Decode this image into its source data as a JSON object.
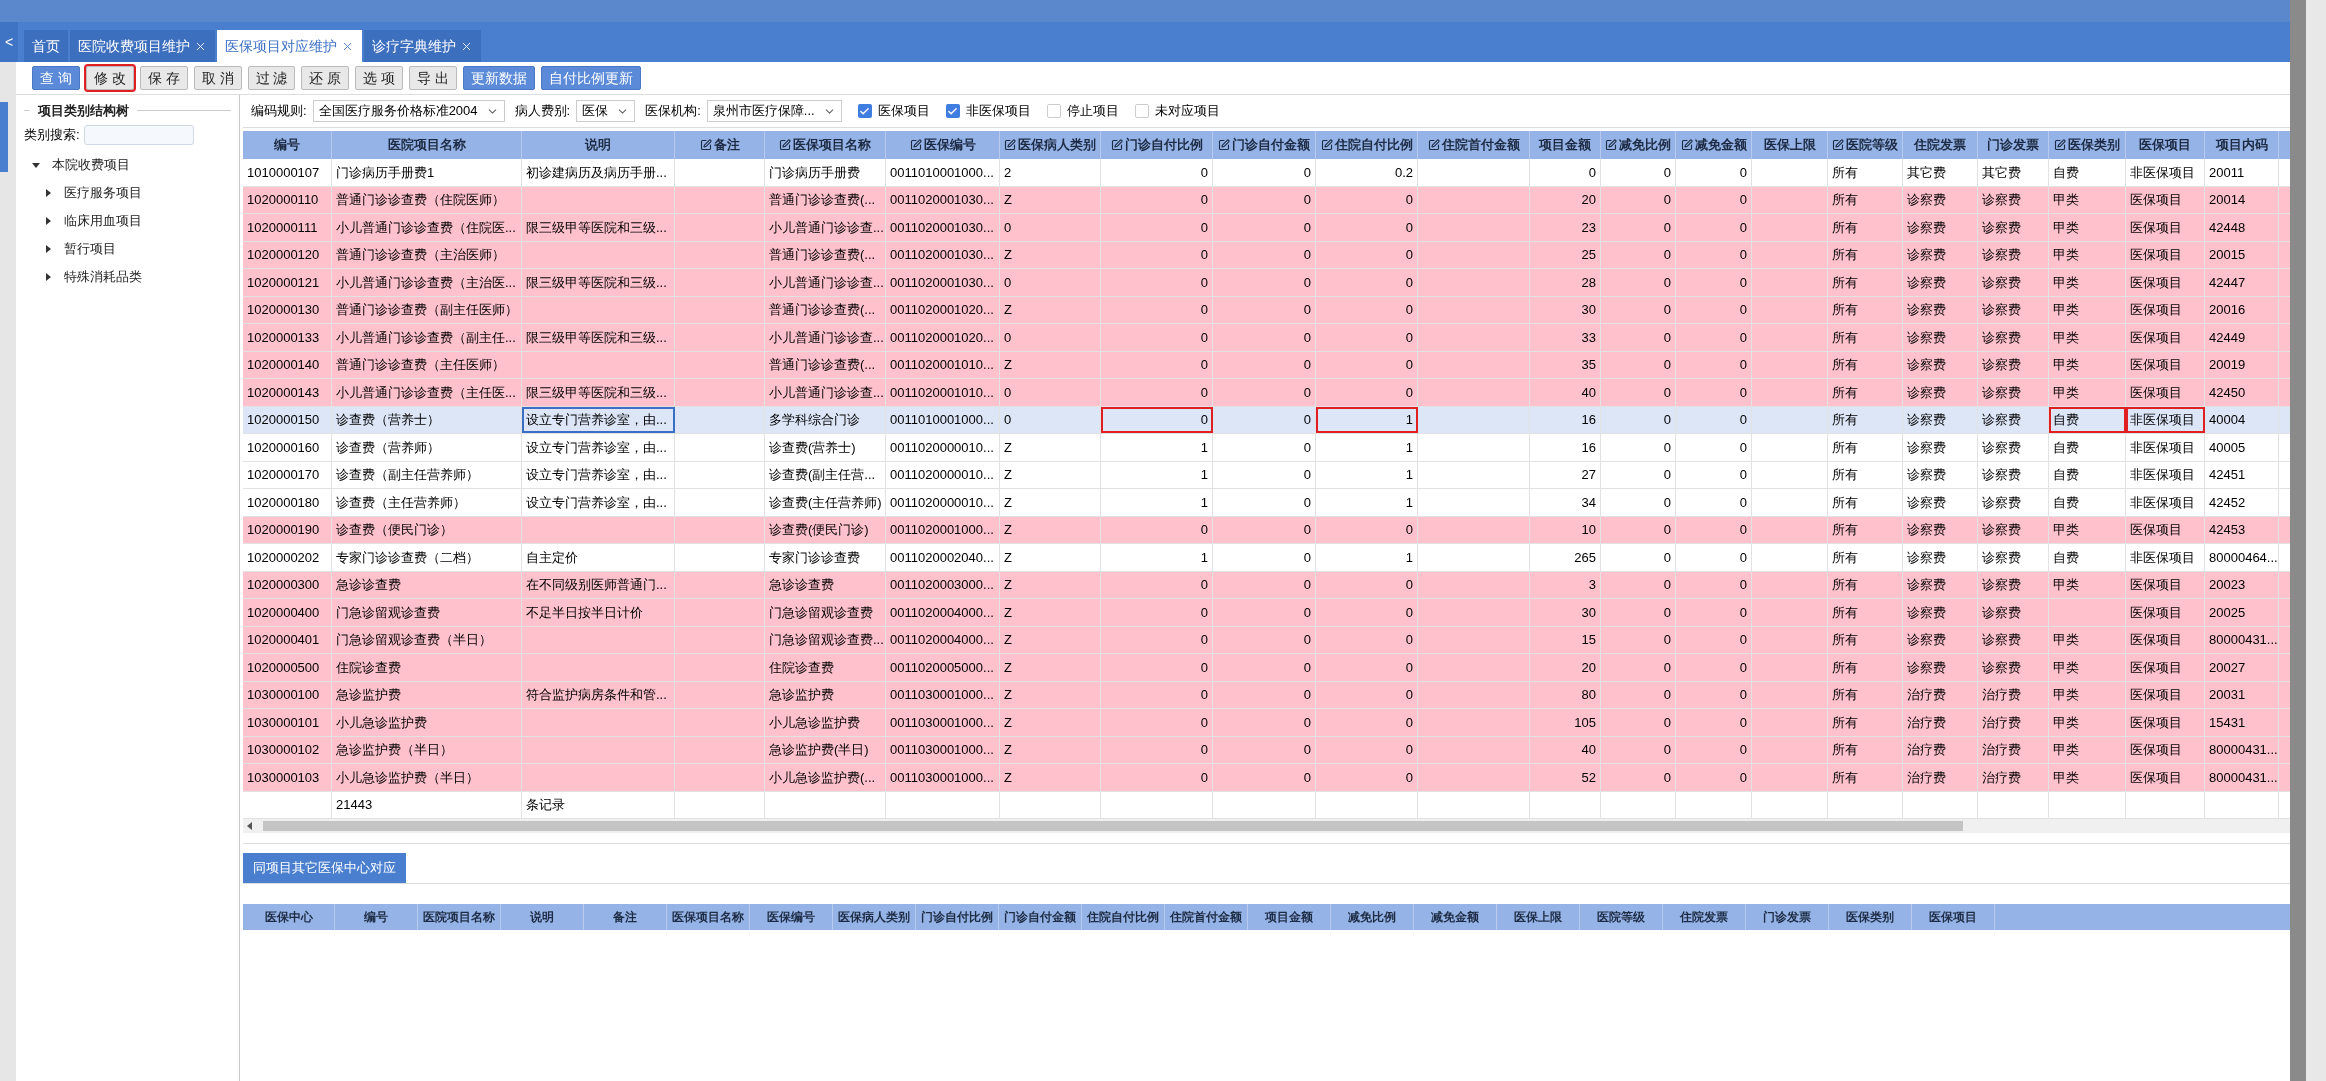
{
  "nav_back": "<",
  "tabs": [
    {
      "label": "首页",
      "closable": false,
      "selected": false
    },
    {
      "label": "医院收费项目维护",
      "closable": true,
      "selected": false
    },
    {
      "label": "医保项目对应维护",
      "closable": true,
      "selected": true
    },
    {
      "label": "诊疗字典维护",
      "closable": true,
      "selected": false
    }
  ],
  "toolbar": [
    {
      "label": "查 询",
      "kind": "primary",
      "marked": false
    },
    {
      "label": "修 改",
      "kind": "default",
      "marked": true
    },
    {
      "label": "保 存",
      "kind": "default",
      "marked": false
    },
    {
      "label": "取 消",
      "kind": "default",
      "marked": false
    },
    {
      "label": "过 滤",
      "kind": "default",
      "marked": false
    },
    {
      "label": "还 原",
      "kind": "default",
      "marked": false
    },
    {
      "label": "选 项",
      "kind": "default",
      "marked": false
    },
    {
      "label": "导 出",
      "kind": "default",
      "marked": false
    },
    {
      "label": "更新数据",
      "kind": "primary",
      "marked": false
    },
    {
      "label": "自付比例更新",
      "kind": "primary",
      "marked": false
    }
  ],
  "sidebar": {
    "title": "项目类别结构树",
    "search_label": "类别搜索:",
    "tree": [
      {
        "label": "本院收费项目",
        "expanded": true,
        "children": [
          {
            "label": "医疗服务项目",
            "expanded": false
          },
          {
            "label": "临床用血项目",
            "expanded": false
          },
          {
            "label": "暂行项目",
            "expanded": false
          },
          {
            "label": "特殊消耗品类",
            "expanded": false
          }
        ]
      }
    ]
  },
  "filters": {
    "selects": [
      {
        "label": "编码规则:",
        "value": "全国医疗服务价格标准2004"
      },
      {
        "label": "病人费别:",
        "value": "医保"
      },
      {
        "label": "医保机构:",
        "value": "泉州市医疗保障..."
      }
    ],
    "checkboxes": [
      {
        "label": "医保项目",
        "checked": true
      },
      {
        "label": "非医保项目",
        "checked": true
      },
      {
        "label": "停止项目",
        "checked": false
      },
      {
        "label": "未对应项目",
        "checked": false
      }
    ]
  },
  "table": {
    "columns": [
      {
        "label": "编号",
        "editable": false,
        "kind": "text"
      },
      {
        "label": "医院项目名称",
        "editable": false,
        "kind": "text"
      },
      {
        "label": "说明",
        "editable": false,
        "kind": "text"
      },
      {
        "label": "备注",
        "editable": true,
        "kind": "text"
      },
      {
        "label": "医保项目名称",
        "editable": true,
        "kind": "text"
      },
      {
        "label": "医保编号",
        "editable": true,
        "kind": "text"
      },
      {
        "label": "医保病人类别",
        "editable": true,
        "kind": "text"
      },
      {
        "label": "门诊自付比例",
        "editable": true,
        "kind": "number"
      },
      {
        "label": "门诊自付金额",
        "editable": true,
        "kind": "number"
      },
      {
        "label": "住院自付比例",
        "editable": true,
        "kind": "number"
      },
      {
        "label": "住院首付金额",
        "editable": true,
        "kind": "number"
      },
      {
        "label": "项目金额",
        "editable": false,
        "kind": "number"
      },
      {
        "label": "减免比例",
        "editable": true,
        "kind": "number"
      },
      {
        "label": "减免金额",
        "editable": true,
        "kind": "number"
      },
      {
        "label": "医保上限",
        "editable": false,
        "kind": "number"
      },
      {
        "label": "医院等级",
        "editable": true,
        "kind": "text"
      },
      {
        "label": "住院发票",
        "editable": false,
        "kind": "text"
      },
      {
        "label": "门诊发票",
        "editable": false,
        "kind": "text"
      },
      {
        "label": "医保类别",
        "editable": true,
        "kind": "text"
      },
      {
        "label": "医保项目",
        "editable": false,
        "kind": "text"
      },
      {
        "label": "项目内码",
        "editable": false,
        "kind": "text"
      }
    ],
    "rows": [
      {
        "flagged": false,
        "selected": false,
        "cells": [
          "1010000107",
          "门诊病历手册费1",
          "初诊建病历及病历手册...",
          "",
          "门诊病历手册费",
          "0011010001000...",
          "2",
          "0",
          "0",
          "0.2",
          "",
          "0",
          "0",
          "0",
          "",
          "所有",
          "其它费",
          "其它费",
          "自费",
          "非医保项目",
          "20011"
        ]
      },
      {
        "flagged": true,
        "selected": false,
        "cells": [
          "1020000110",
          "普通门诊诊查费（住院医师）",
          "",
          "",
          "普通门诊诊查费(...",
          "0011020001030...",
          "Z",
          "0",
          "0",
          "0",
          "",
          "20",
          "0",
          "0",
          "",
          "所有",
          "诊察费",
          "诊察费",
          "甲类",
          "医保项目",
          "20014"
        ]
      },
      {
        "flagged": true,
        "selected": false,
        "cells": [
          "1020000111",
          "小儿普通门诊诊查费（住院医...",
          "限三级甲等医院和三级...",
          "",
          "小儿普通门诊诊查...",
          "0011020001030...",
          "0",
          "0",
          "0",
          "0",
          "",
          "23",
          "0",
          "0",
          "",
          "所有",
          "诊察费",
          "诊察费",
          "甲类",
          "医保项目",
          "42448"
        ]
      },
      {
        "flagged": true,
        "selected": false,
        "cells": [
          "1020000120",
          "普通门诊诊查费（主治医师）",
          "",
          "",
          "普通门诊诊查费(...",
          "0011020001030...",
          "Z",
          "0",
          "0",
          "0",
          "",
          "25",
          "0",
          "0",
          "",
          "所有",
          "诊察费",
          "诊察费",
          "甲类",
          "医保项目",
          "20015"
        ]
      },
      {
        "flagged": true,
        "selected": false,
        "cells": [
          "1020000121",
          "小儿普通门诊诊查费（主治医...",
          "限三级甲等医院和三级...",
          "",
          "小儿普通门诊诊查...",
          "0011020001030...",
          "0",
          "0",
          "0",
          "0",
          "",
          "28",
          "0",
          "0",
          "",
          "所有",
          "诊察费",
          "诊察费",
          "甲类",
          "医保项目",
          "42447"
        ]
      },
      {
        "flagged": true,
        "selected": false,
        "cells": [
          "1020000130",
          "普通门诊诊查费（副主任医师）",
          "",
          "",
          "普通门诊诊查费(...",
          "0011020001020...",
          "Z",
          "0",
          "0",
          "0",
          "",
          "30",
          "0",
          "0",
          "",
          "所有",
          "诊察费",
          "诊察费",
          "甲类",
          "医保项目",
          "20016"
        ]
      },
      {
        "flagged": true,
        "selected": false,
        "cells": [
          "1020000133",
          "小儿普通门诊诊查费（副主任...",
          "限三级甲等医院和三级...",
          "",
          "小儿普通门诊诊查...",
          "0011020001020...",
          "0",
          "0",
          "0",
          "0",
          "",
          "33",
          "0",
          "0",
          "",
          "所有",
          "诊察费",
          "诊察费",
          "甲类",
          "医保项目",
          "42449"
        ]
      },
      {
        "flagged": true,
        "selected": false,
        "cells": [
          "1020000140",
          "普通门诊诊查费（主任医师）",
          "",
          "",
          "普通门诊诊查费(...",
          "0011020001010...",
          "Z",
          "0",
          "0",
          "0",
          "",
          "35",
          "0",
          "0",
          "",
          "所有",
          "诊察费",
          "诊察费",
          "甲类",
          "医保项目",
          "20019"
        ]
      },
      {
        "flagged": true,
        "selected": false,
        "cells": [
          "1020000143",
          "小儿普通门诊诊查费（主任医...",
          "限三级甲等医院和三级...",
          "",
          "小儿普通门诊诊查...",
          "0011020001010...",
          "0",
          "0",
          "0",
          "0",
          "",
          "40",
          "0",
          "0",
          "",
          "所有",
          "诊察费",
          "诊察费",
          "甲类",
          "医保项目",
          "42450"
        ]
      },
      {
        "flagged": false,
        "selected": true,
        "cells": [
          "1020000150",
          "诊查费（营养士）",
          {
            "text": "设立专门营养诊室，由...",
            "focused": true
          },
          "",
          "多学科综合门诊",
          "0011010001000...",
          "0",
          {
            "text": "0",
            "marked": true
          },
          "0",
          {
            "text": "1",
            "marked": true
          },
          "",
          "16",
          "0",
          "0",
          "",
          "所有",
          "诊察费",
          "诊察费",
          {
            "text": "自费",
            "marked": true
          },
          {
            "text": "非医保项目",
            "marked": true
          },
          "40004"
        ]
      },
      {
        "flagged": false,
        "selected": false,
        "cells": [
          "1020000160",
          "诊查费（营养师）",
          "设立专门营养诊室，由...",
          "",
          "诊查费(营养士)",
          "0011020000010...",
          "Z",
          "1",
          "0",
          "1",
          "",
          "16",
          "0",
          "0",
          "",
          "所有",
          "诊察费",
          "诊察费",
          "自费",
          "非医保项目",
          "40005"
        ]
      },
      {
        "flagged": false,
        "selected": false,
        "cells": [
          "1020000170",
          "诊查费（副主任营养师）",
          "设立专门营养诊室，由...",
          "",
          "诊查费(副主任营...",
          "0011020000010...",
          "Z",
          "1",
          "0",
          "1",
          "",
          "27",
          "0",
          "0",
          "",
          "所有",
          "诊察费",
          "诊察费",
          "自费",
          "非医保项目",
          "42451"
        ]
      },
      {
        "flagged": false,
        "selected": false,
        "cells": [
          "1020000180",
          "诊查费（主任营养师）",
          "设立专门营养诊室，由...",
          "",
          "诊查费(主任营养师)",
          "0011020000010...",
          "Z",
          "1",
          "0",
          "1",
          "",
          "34",
          "0",
          "0",
          "",
          "所有",
          "诊察费",
          "诊察费",
          "自费",
          "非医保项目",
          "42452"
        ]
      },
      {
        "flagged": true,
        "selected": false,
        "cells": [
          "1020000190",
          "诊查费（便民门诊）",
          "",
          "",
          "诊查费(便民门诊)",
          "0011020001000...",
          "Z",
          "0",
          "0",
          "0",
          "",
          "10",
          "0",
          "0",
          "",
          "所有",
          "诊察费",
          "诊察费",
          "甲类",
          "医保项目",
          "42453"
        ]
      },
      {
        "flagged": false,
        "selected": false,
        "cells": [
          "1020000202",
          "专家门诊诊查费（二档）",
          "自主定价",
          "",
          "专家门诊诊查费",
          "0011020002040...",
          "Z",
          "1",
          "0",
          "1",
          "",
          "265",
          "0",
          "0",
          "",
          "所有",
          "诊察费",
          "诊察费",
          "自费",
          "非医保项目",
          "80000464..."
        ]
      },
      {
        "flagged": true,
        "selected": false,
        "cells": [
          "1020000300",
          "急诊诊查费",
          "在不同级别医师普通门...",
          "",
          "急诊诊查费",
          "0011020003000...",
          "Z",
          "0",
          "0",
          "0",
          "",
          "3",
          "0",
          "0",
          "",
          "所有",
          "诊察费",
          "诊察费",
          "甲类",
          "医保项目",
          "20023"
        ]
      },
      {
        "flagged": true,
        "selected": false,
        "cells": [
          "1020000400",
          "门急诊留观诊查费",
          "不足半日按半日计价",
          "",
          "门急诊留观诊查费",
          "0011020004000...",
          "Z",
          "0",
          "0",
          "0",
          "",
          "30",
          "0",
          "0",
          "",
          "所有",
          "诊察费",
          "诊察费",
          "",
          "医保项目",
          "20025"
        ]
      },
      {
        "flagged": true,
        "selected": false,
        "cells": [
          "1020000401",
          "门急诊留观诊查费（半日）",
          "",
          "",
          "门急诊留观诊查费...",
          "0011020004000...",
          "Z",
          "0",
          "0",
          "0",
          "",
          "15",
          "0",
          "0",
          "",
          "所有",
          "诊察费",
          "诊察费",
          "甲类",
          "医保项目",
          "80000431..."
        ]
      },
      {
        "flagged": true,
        "selected": false,
        "cells": [
          "1020000500",
          "住院诊查费",
          "",
          "",
          "住院诊查费",
          "0011020005000...",
          "Z",
          "0",
          "0",
          "0",
          "",
          "20",
          "0",
          "0",
          "",
          "所有",
          "诊察费",
          "诊察费",
          "甲类",
          "医保项目",
          "20027"
        ]
      },
      {
        "flagged": true,
        "selected": false,
        "cells": [
          "1030000100",
          "急诊监护费",
          "符合监护病房条件和管...",
          "",
          "急诊监护费",
          "0011030001000...",
          "Z",
          "0",
          "0",
          "0",
          "",
          "80",
          "0",
          "0",
          "",
          "所有",
          "治疗费",
          "治疗费",
          "甲类",
          "医保项目",
          "20031"
        ]
      },
      {
        "flagged": true,
        "selected": false,
        "cells": [
          "1030000101",
          "小儿急诊监护费",
          "",
          "",
          "小儿急诊监护费",
          "0011030001000...",
          "Z",
          "0",
          "0",
          "0",
          "",
          "105",
          "0",
          "0",
          "",
          "所有",
          "治疗费",
          "治疗费",
          "甲类",
          "医保项目",
          "15431"
        ]
      },
      {
        "flagged": true,
        "selected": false,
        "cells": [
          "1030000102",
          "急诊监护费（半日）",
          "",
          "",
          "急诊监护费(半日)",
          "0011030001000...",
          "Z",
          "0",
          "0",
          "0",
          "",
          "40",
          "0",
          "0",
          "",
          "所有",
          "治疗费",
          "治疗费",
          "甲类",
          "医保项目",
          "80000431..."
        ]
      },
      {
        "flagged": true,
        "selected": false,
        "cells": [
          "1030000103",
          "小儿急诊监护费（半日）",
          "",
          "",
          "小儿急诊监护费(...",
          "0011030001000...",
          "Z",
          "0",
          "0",
          "0",
          "",
          "52",
          "0",
          "0",
          "",
          "所有",
          "治疗费",
          "治疗费",
          "甲类",
          "医保项目",
          "80000431..."
        ]
      }
    ],
    "footer": {
      "count": "21443",
      "unit": "条记录"
    }
  },
  "bottom_panel": {
    "tab": "同项目其它医保中心对应",
    "columns": [
      "医保中心",
      "编号",
      "医院项目名称",
      "说明",
      "备注",
      "医保项目名称",
      "医保编号",
      "医保病人类别",
      "门诊自付比例",
      "门诊自付金额",
      "住院自付比例",
      "住院首付金额",
      "项目金额",
      "减免比例",
      "减免金额",
      "医保上限",
      "医院等级",
      "住院发票",
      "门诊发票",
      "医保类别",
      "医保项目"
    ]
  }
}
